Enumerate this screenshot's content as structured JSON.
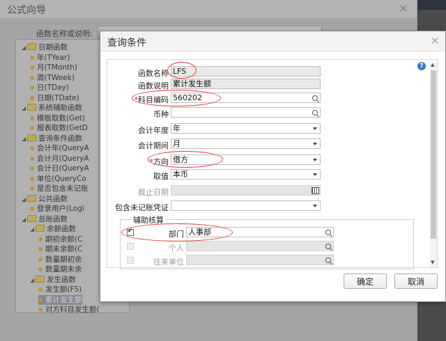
{
  "wizard": {
    "title": "公式向导",
    "close_glyph": "×",
    "fn_label": "函数名称或说明:",
    "tree": [
      {
        "type": "folder",
        "label": "日期函数",
        "depth": 0
      },
      {
        "type": "leaf",
        "label": "年(TYear)",
        "depth": 1
      },
      {
        "type": "leaf",
        "label": "月(TMonth)",
        "depth": 1
      },
      {
        "type": "leaf",
        "label": "周(TWeek)",
        "depth": 1
      },
      {
        "type": "leaf",
        "label": "日(TDay)",
        "depth": 1
      },
      {
        "type": "leaf",
        "label": "日期(TDate)",
        "depth": 1
      },
      {
        "type": "folder",
        "label": "系统辅助函数",
        "depth": 0
      },
      {
        "type": "leaf",
        "label": "模板取数(Get)",
        "depth": 1
      },
      {
        "type": "leaf",
        "label": "报表取数(GetD",
        "depth": 1
      },
      {
        "type": "folder",
        "label": "查询条件函数",
        "depth": 0
      },
      {
        "type": "leaf",
        "label": "会计年(QueryA",
        "depth": 1
      },
      {
        "type": "leaf",
        "label": "会计月(QueryA",
        "depth": 1
      },
      {
        "type": "leaf",
        "label": "会计日(QueryA",
        "depth": 1
      },
      {
        "type": "leaf",
        "label": "单位(QueryCo",
        "depth": 1
      },
      {
        "type": "leaf",
        "label": "是否包含未记账",
        "depth": 1
      },
      {
        "type": "folder",
        "label": "公共函数",
        "depth": 0
      },
      {
        "type": "leaf",
        "label": "登录用户(Logi",
        "depth": 1
      },
      {
        "type": "folder",
        "label": "总账函数",
        "depth": 0
      },
      {
        "type": "folder",
        "label": "余额函数",
        "depth": 1
      },
      {
        "type": "leaf",
        "label": "期初余额(C",
        "depth": 2
      },
      {
        "type": "leaf",
        "label": "期末余额(C",
        "depth": 2
      },
      {
        "type": "leaf",
        "label": "数量期初余",
        "depth": 2
      },
      {
        "type": "leaf",
        "label": "数量期末余",
        "depth": 2
      },
      {
        "type": "folder",
        "label": "发生函数",
        "depth": 1
      },
      {
        "type": "leaf",
        "label": "发生额(FS)",
        "depth": 2
      },
      {
        "type": "leaf",
        "label": "累计发生额",
        "depth": 2,
        "selected": true
      },
      {
        "type": "leaf",
        "label": "对方科目发生额(",
        "depth": 2
      }
    ]
  },
  "dialog": {
    "title": "查询条件",
    "close_glyph": "×",
    "help_glyph": "?",
    "fields": {
      "fn_name": {
        "label": "函数名称",
        "value": "LFS"
      },
      "fn_desc": {
        "label": "函数说明",
        "value": "累计发生额"
      },
      "account_code": {
        "required": "*",
        "label": "科目编码",
        "value": "560202"
      },
      "currency": {
        "label": "币种",
        "value": ""
      },
      "fiscal_year": {
        "label": "会计年度",
        "value": "年"
      },
      "fiscal_period": {
        "label": "会计期间",
        "value": "月"
      },
      "direction": {
        "required": "*",
        "label": "方向",
        "value": "借方"
      },
      "value_type": {
        "label": "取值",
        "value": "本币"
      },
      "end_date": {
        "label": "截止日期",
        "value": ""
      },
      "include_unposted": {
        "label": "包含未记账凭证",
        "value": ""
      }
    },
    "aux": {
      "legend": "辅助核算",
      "items": [
        {
          "label": "部门",
          "value": "人事部",
          "checked": true,
          "enabled": true
        },
        {
          "label": "个人",
          "value": "",
          "checked": false,
          "enabled": false
        },
        {
          "label": "往来单位",
          "value": "",
          "checked": false,
          "enabled": false
        }
      ]
    },
    "buttons": {
      "ok": "确定",
      "cancel": "取消"
    }
  },
  "colors": {
    "annotation": "#e23a3a",
    "accent": "#3e78c9"
  }
}
